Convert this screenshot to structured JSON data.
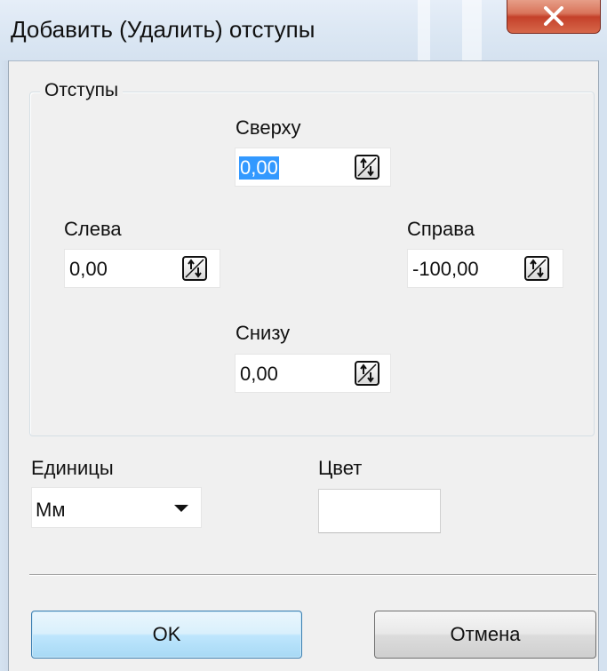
{
  "window": {
    "title": "Добавить (Удалить) отступы"
  },
  "group": {
    "legend": "Отступы"
  },
  "fields": {
    "top": {
      "label": "Сверху",
      "value": "0,00"
    },
    "left": {
      "label": "Слева",
      "value": "0,00"
    },
    "right": {
      "label": "Справа",
      "value": "-100,00"
    },
    "bottom": {
      "label": "Снизу",
      "value": "0,00"
    }
  },
  "units": {
    "label": "Единицы",
    "selected": "Мм"
  },
  "color": {
    "label": "Цвет",
    "value_hex": "#ffffff"
  },
  "buttons": {
    "ok": "OK",
    "cancel": "Отмена"
  },
  "icons": {
    "close": "close-icon",
    "spinner": "spinner-arrows-icon",
    "dropdown": "chevron-down-icon"
  },
  "colors": {
    "selection": "#3399ff",
    "close_button": "#c4412a",
    "default_button_border": "#3c7fb1"
  }
}
